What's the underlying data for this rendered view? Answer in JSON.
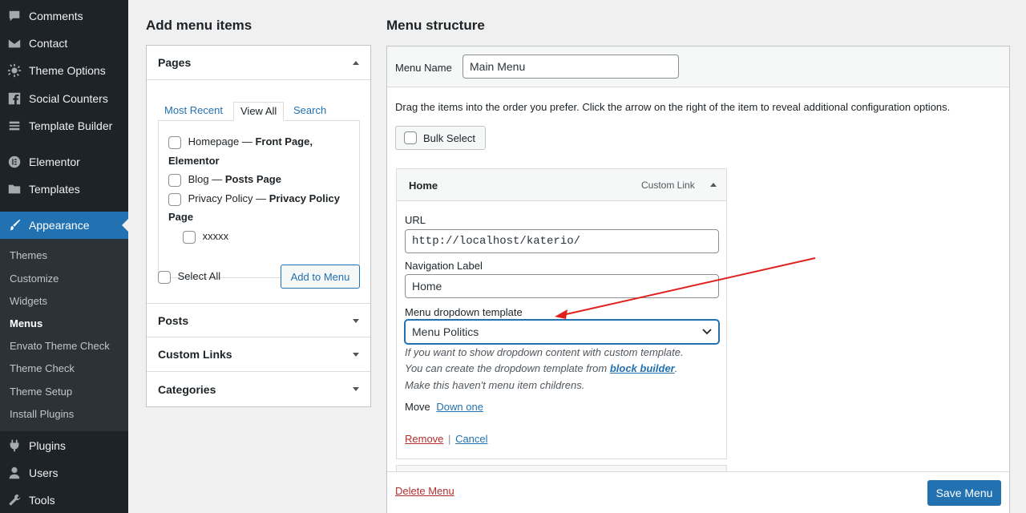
{
  "sidebar": {
    "top_items": [
      {
        "label": "Comments",
        "icon": "comment-icon"
      },
      {
        "label": "Contact",
        "icon": "mail-icon"
      },
      {
        "label": "Theme Options",
        "icon": "gear-icon"
      },
      {
        "label": "Social Counters",
        "icon": "facebook-icon"
      },
      {
        "label": "Template Builder",
        "icon": "list-icon"
      },
      {
        "label": "Elementor",
        "icon": "elementor-icon"
      },
      {
        "label": "Templates",
        "icon": "folder-icon"
      },
      {
        "label": "Appearance",
        "icon": "paintbrush-icon"
      }
    ],
    "submenu": [
      "Themes",
      "Customize",
      "Widgets",
      "Menus",
      "Envato Theme Check",
      "Theme Check",
      "Theme Setup",
      "Install Plugins"
    ],
    "bottom_items": [
      {
        "label": "Plugins",
        "icon": "plug-icon"
      },
      {
        "label": "Users",
        "icon": "user-icon"
      },
      {
        "label": "Tools",
        "icon": "wrench-icon"
      }
    ],
    "colors": {
      "bg": "#1d2327",
      "active": "#2271b1",
      "submenu_bg": "#2c3338"
    }
  },
  "add_items": {
    "title": "Add menu items",
    "pages": {
      "title": "Pages",
      "tabs": [
        "Most Recent",
        "View All",
        "Search"
      ],
      "lines": [
        {
          "pre": "Homepage — ",
          "bold": "Front Page,"
        },
        {
          "bold": "Elementor"
        },
        {
          "pre": "Blog — ",
          "bold": "Posts Page"
        },
        {
          "pre": "Privacy Policy — ",
          "bold": "Privacy Policy"
        },
        {
          "bold": "Page"
        },
        {
          "pre": "xxxxx"
        }
      ],
      "select_all": "Select All",
      "add_button": "Add to Menu"
    },
    "sections": [
      "Posts",
      "Custom Links",
      "Categories"
    ]
  },
  "menu_structure": {
    "title": "Menu structure",
    "menu_name_label": "Menu Name",
    "menu_name_value": "Main Menu",
    "instructions": "Drag the items into the order you prefer. Click the arrow on the right of the item to reveal additional configuration options.",
    "bulk_select": "Bulk Select",
    "item": {
      "title": "Home",
      "type": "Custom Link",
      "url_label": "URL",
      "url_value": "http://localhost/katerio/",
      "nav_label": "Navigation Label",
      "nav_value": "Home",
      "dropdown_label": "Menu dropdown template",
      "dropdown_value": "Menu Politics",
      "desc1": "If you want to show dropdown content with custom template.",
      "desc2_pre": "You can create the dropdown template from ",
      "desc2_link": "block builder",
      "desc2_post": ".",
      "desc3": "Make this haven't menu item childrens.",
      "move_label": "Move",
      "move_link": "Down one",
      "remove": "Remove",
      "separator": "|",
      "cancel": "Cancel"
    },
    "delete_menu": "Delete Menu",
    "save_menu": "Save Menu"
  },
  "annotation_color": "#e0201c"
}
